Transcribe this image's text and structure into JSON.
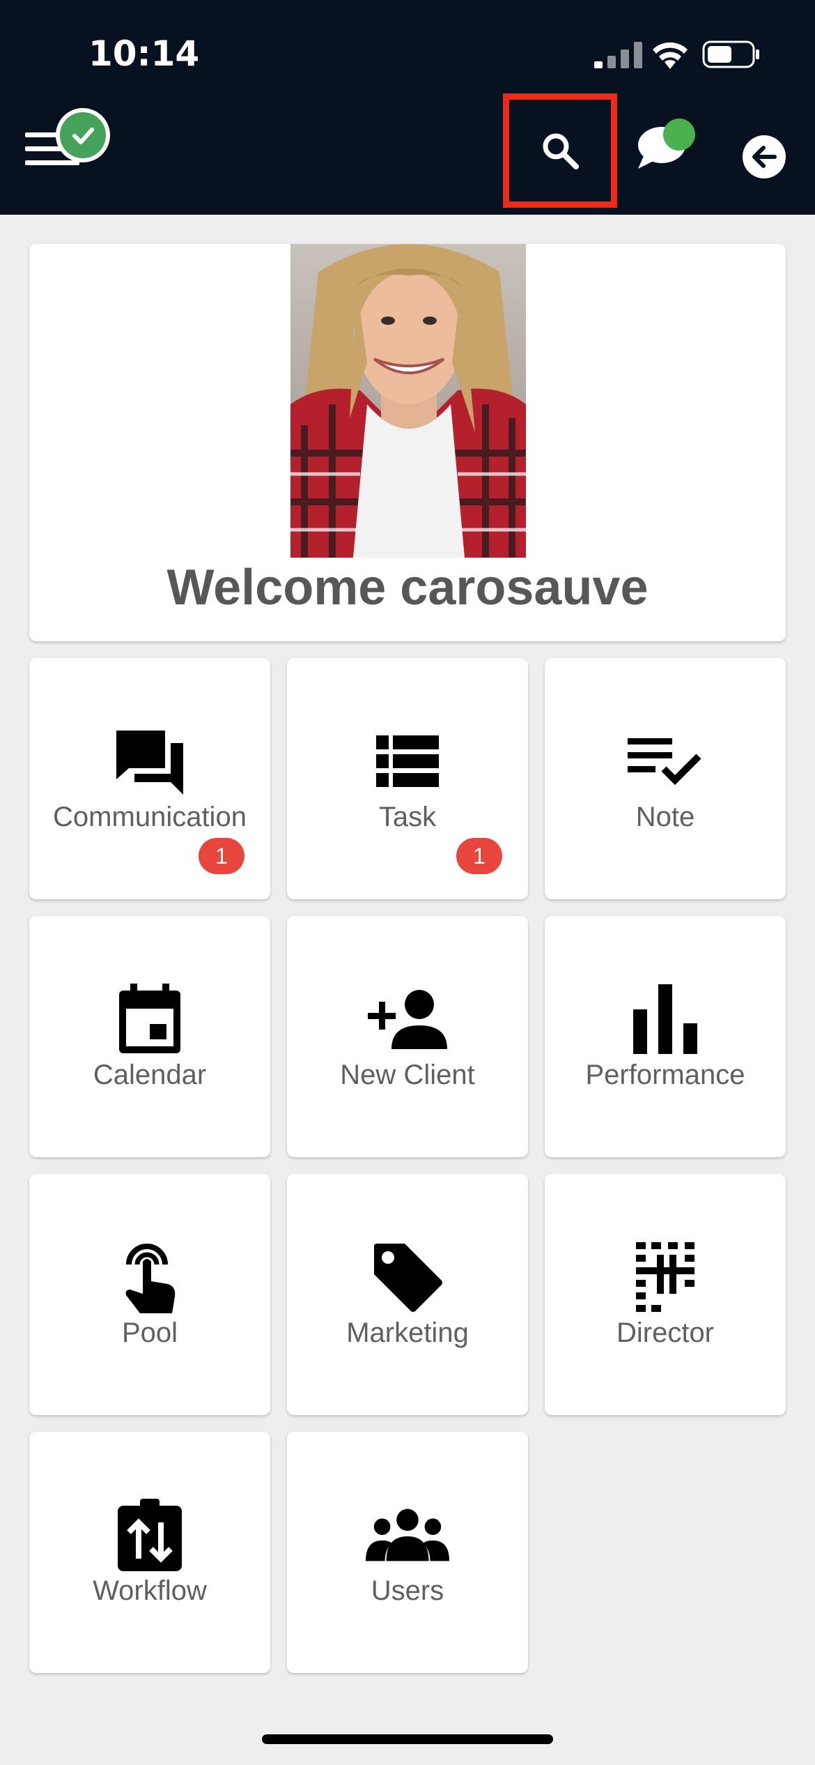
{
  "status_bar": {
    "time": "10:14"
  },
  "header": {
    "menu_icon": "hamburger-icon",
    "online_status_icon": "check-circle-icon",
    "search_icon": "search-icon",
    "chat_icon": "chat-bubble-icon",
    "back_icon": "arrow-left-circle-icon",
    "highlight_color": "#ec2b1b",
    "status_color": "#45a25a"
  },
  "welcome": {
    "text": "Welcome carosauve"
  },
  "tiles": [
    {
      "label": "Communication",
      "icon": "forum-icon",
      "badge": "1"
    },
    {
      "label": "Task",
      "icon": "list-icon",
      "badge": "1"
    },
    {
      "label": "Note",
      "icon": "playlist-check-icon"
    },
    {
      "label": "Calendar",
      "icon": "calendar-icon"
    },
    {
      "label": "New Client",
      "icon": "person-add-icon"
    },
    {
      "label": "Performance",
      "icon": "bar-chart-icon"
    },
    {
      "label": "Pool",
      "icon": "touch-icon"
    },
    {
      "label": "Marketing",
      "icon": "tag-icon"
    },
    {
      "label": "Director",
      "icon": "director-icon"
    },
    {
      "label": "Workflow",
      "icon": "workflow-icon"
    },
    {
      "label": "Users",
      "icon": "group-icon"
    }
  ],
  "colors": {
    "header_bg": "#07111f",
    "badge": "#e8453c",
    "page_bg": "#eeeeee"
  }
}
